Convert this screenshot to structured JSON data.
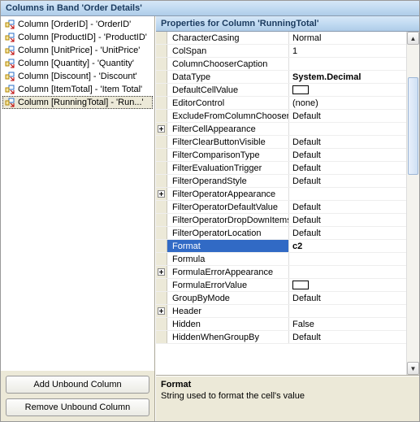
{
  "title_bar": "Columns in Band 'Order Details'",
  "columns": [
    {
      "label": "Column [OrderID] - 'OrderID'",
      "selected": false
    },
    {
      "label": "Column [ProductID] - 'ProductID'",
      "selected": false
    },
    {
      "label": "Column [UnitPrice] - 'UnitPrice'",
      "selected": false
    },
    {
      "label": "Column [Quantity] - 'Quantity'",
      "selected": false
    },
    {
      "label": "Column [Discount] - 'Discount'",
      "selected": false
    },
    {
      "label": "Column [ItemTotal] - 'Item Total'",
      "selected": false
    },
    {
      "label": "Column [RunningTotal] - 'Run...'",
      "selected": true
    }
  ],
  "buttons": {
    "add": "Add Unbound Column",
    "remove": "Remove Unbound Column"
  },
  "prop_header": "Properties for Column 'RunningTotal'",
  "properties": [
    {
      "name": "CharacterCasing",
      "value": "Normal",
      "expand": ""
    },
    {
      "name": "ColSpan",
      "value": "1",
      "expand": ""
    },
    {
      "name": "ColumnChooserCaption",
      "value": "",
      "expand": ""
    },
    {
      "name": "DataType",
      "value": "System.Decimal",
      "expand": "",
      "bold": true
    },
    {
      "name": "DefaultCellValue",
      "value": "",
      "expand": "",
      "swatch": true
    },
    {
      "name": "EditorControl",
      "value": "(none)",
      "expand": ""
    },
    {
      "name": "ExcludeFromColumnChooser",
      "value": "Default",
      "expand": ""
    },
    {
      "name": "FilterCellAppearance",
      "value": "",
      "expand": "+"
    },
    {
      "name": "FilterClearButtonVisible",
      "value": "Default",
      "expand": ""
    },
    {
      "name": "FilterComparisonType",
      "value": "Default",
      "expand": ""
    },
    {
      "name": "FilterEvaluationTrigger",
      "value": "Default",
      "expand": ""
    },
    {
      "name": "FilterOperandStyle",
      "value": "Default",
      "expand": ""
    },
    {
      "name": "FilterOperatorAppearance",
      "value": "",
      "expand": "+"
    },
    {
      "name": "FilterOperatorDefaultValue",
      "value": "Default",
      "expand": ""
    },
    {
      "name": "FilterOperatorDropDownItems",
      "value": "Default",
      "expand": ""
    },
    {
      "name": "FilterOperatorLocation",
      "value": "Default",
      "expand": ""
    },
    {
      "name": "Format",
      "value": "c2",
      "expand": "",
      "selected": true,
      "bold": true
    },
    {
      "name": "Formula",
      "value": "",
      "expand": ""
    },
    {
      "name": "FormulaErrorAppearance",
      "value": "",
      "expand": "+"
    },
    {
      "name": "FormulaErrorValue",
      "value": "",
      "expand": "",
      "swatch": true
    },
    {
      "name": "GroupByMode",
      "value": "Default",
      "expand": ""
    },
    {
      "name": "Header",
      "value": "",
      "expand": "+"
    },
    {
      "name": "Hidden",
      "value": "False",
      "expand": ""
    },
    {
      "name": "HiddenWhenGroupBy",
      "value": "Default",
      "expand": ""
    }
  ],
  "description": {
    "title": "Format",
    "text": "String used to format the cell's value"
  }
}
